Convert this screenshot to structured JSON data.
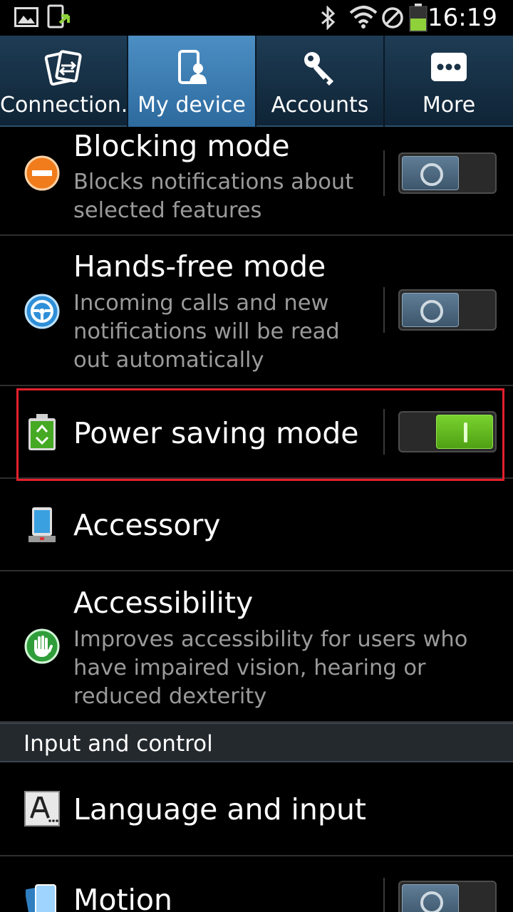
{
  "status_bar": {
    "time": "16:19",
    "icons": [
      "gallery-icon",
      "download-icon",
      "bluetooth-icon",
      "wifi-icon",
      "blocked-icon",
      "battery-icon"
    ]
  },
  "tabs": [
    {
      "label": "Connection..",
      "icon": "connections-icon",
      "active": false
    },
    {
      "label": "My device",
      "icon": "my-device-icon",
      "active": true
    },
    {
      "label": "Accounts",
      "icon": "key-icon",
      "active": false
    },
    {
      "label": "More",
      "icon": "more-icon",
      "active": false
    }
  ],
  "rows": {
    "blocking": {
      "title": "Blocking mode",
      "description": "Blocks notifications about selected features",
      "toggle": "off"
    },
    "handsfree": {
      "title": "Hands-free mode",
      "description": "Incoming calls and new notifications will be read out automatically",
      "toggle": "off"
    },
    "power": {
      "title": "Power saving mode",
      "toggle": "on"
    },
    "accessory": {
      "title": "Accessory"
    },
    "accessibility": {
      "title": "Accessibility",
      "description": "Improves accessibility for users who have impaired vision, hearing or reduced dexterity"
    },
    "language": {
      "title": "Language and input"
    },
    "motion": {
      "title": "Motion",
      "toggle": "off"
    }
  },
  "section": {
    "label": "Input and control"
  },
  "colors": {
    "highlight": "#e3202d",
    "toggle_on": "#62ba21",
    "tab_active": "#3d7fb5"
  }
}
